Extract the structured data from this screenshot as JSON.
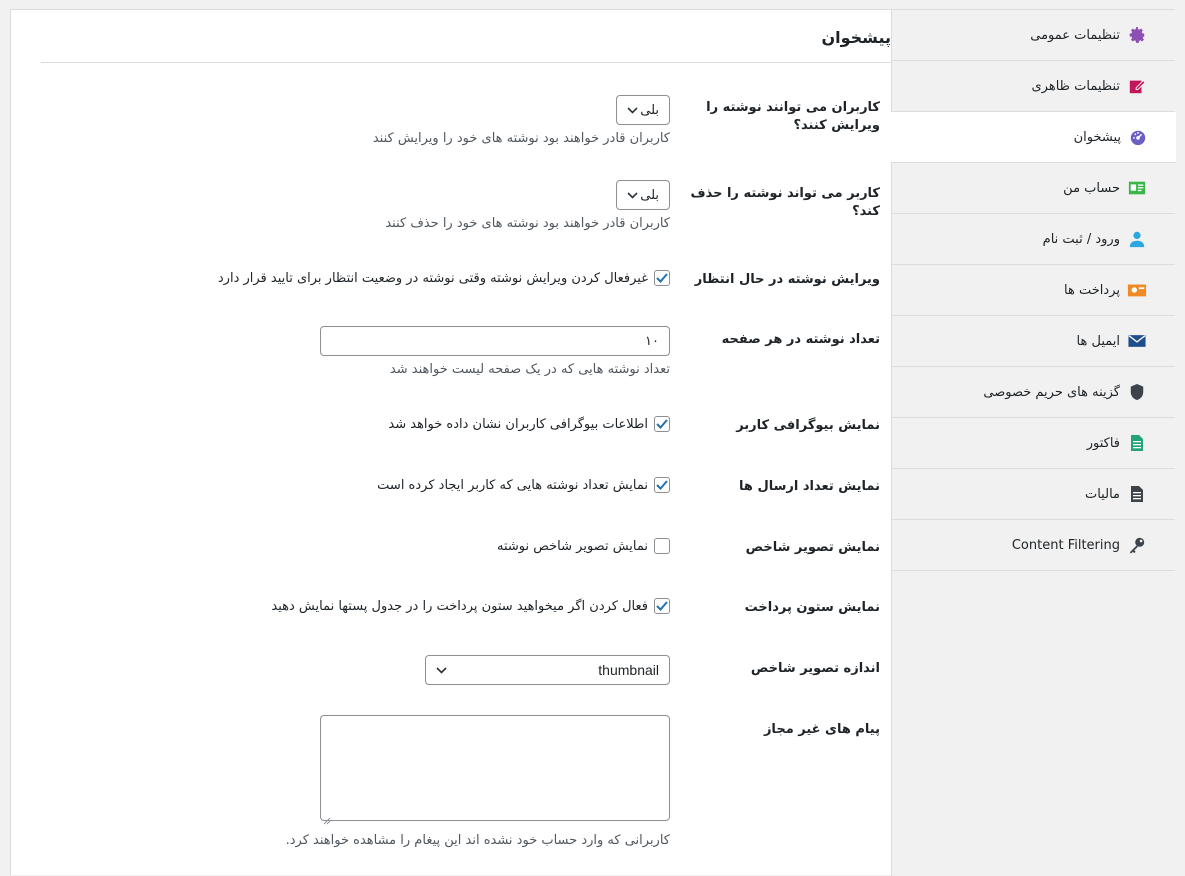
{
  "page": {
    "title": "پیشخوان"
  },
  "sidebar": {
    "items": [
      {
        "label": "تنظیمات عمومی",
        "icon": "gear-icon",
        "color": "#8c4fb3"
      },
      {
        "label": "تنظیمات ظاهری",
        "icon": "edit-icon",
        "color": "#c2185b"
      },
      {
        "label": "پیشخوان",
        "icon": "dashboard-icon",
        "color": "#6b5fc7"
      },
      {
        "label": "حساب من",
        "icon": "id-card-icon",
        "color": "#3ab54a"
      },
      {
        "label": "ورود / ثبت نام",
        "icon": "user-icon",
        "color": "#2aa6e0"
      },
      {
        "label": "پرداخت ها",
        "icon": "payment-icon",
        "color": "#f08a24"
      },
      {
        "label": "ایمیل ها",
        "icon": "mail-icon",
        "color": "#1f4e8c"
      },
      {
        "label": "گزینه های حریم خصوصی",
        "icon": "shield-icon",
        "color": "#3c434a"
      },
      {
        "label": "فاکتور",
        "icon": "invoice-icon",
        "color": "#22a37a"
      },
      {
        "label": "مالیات",
        "icon": "document-icon",
        "color": "#3c434a"
      },
      {
        "label": "Content Filtering",
        "icon": "key-icon",
        "color": "#3c434a"
      }
    ],
    "active_index": 2
  },
  "fields": {
    "edit_posts": {
      "label": "کاربران می توانند نوشته را ویرایش کنند؟",
      "value": "بلی",
      "description": "کاربران قادر خواهند بود نوشته های خود را ویرایش کنند"
    },
    "delete_posts": {
      "label": "کاربر می تواند نوشته را حذف کند؟",
      "value": "بلی",
      "description": "کاربران قادر خواهند بود نوشته های خود را حذف کنند"
    },
    "pending_edit": {
      "label": "ویرایش نوشته در حال انتظار",
      "checked": true,
      "text": "غیرفعال کردن ویرایش نوشته وقتی نوشته در وضعیت انتظار برای تایید قرار دارد"
    },
    "posts_per_page": {
      "label": "تعداد نوشته در هر صفحه",
      "value": "۱۰",
      "description": "تعداد نوشته هایی که در یک صفحه لیست خواهند شد"
    },
    "show_bio": {
      "label": "نمایش بیوگرافی کاربر",
      "checked": true,
      "text": "اطلاعات بیوگرافی کاربران نشان داده خواهد شد"
    },
    "show_post_count": {
      "label": "نمایش تعداد ارسال ها",
      "checked": true,
      "text": "نمایش تعداد نوشته هایی که کاربر ایجاد کرده است"
    },
    "show_featured": {
      "label": "نمایش تصویر شاخص",
      "checked": false,
      "text": "نمایش تصویر شاخص نوشته"
    },
    "show_payment_col": {
      "label": "نمایش ستون پرداخت",
      "checked": true,
      "text": "فعال کردن اگر میخواهید ستون پرداخت را در جدول پستها نمایش دهید"
    },
    "featured_size": {
      "label": "اندازه تصویر شاخص",
      "value": "thumbnail"
    },
    "unauth_message": {
      "label": "پیام های غیر مجاز",
      "value": "",
      "description": "کاربرانی که وارد حساب خود نشده اند این پیغام را مشاهده خواهند کرد."
    }
  }
}
